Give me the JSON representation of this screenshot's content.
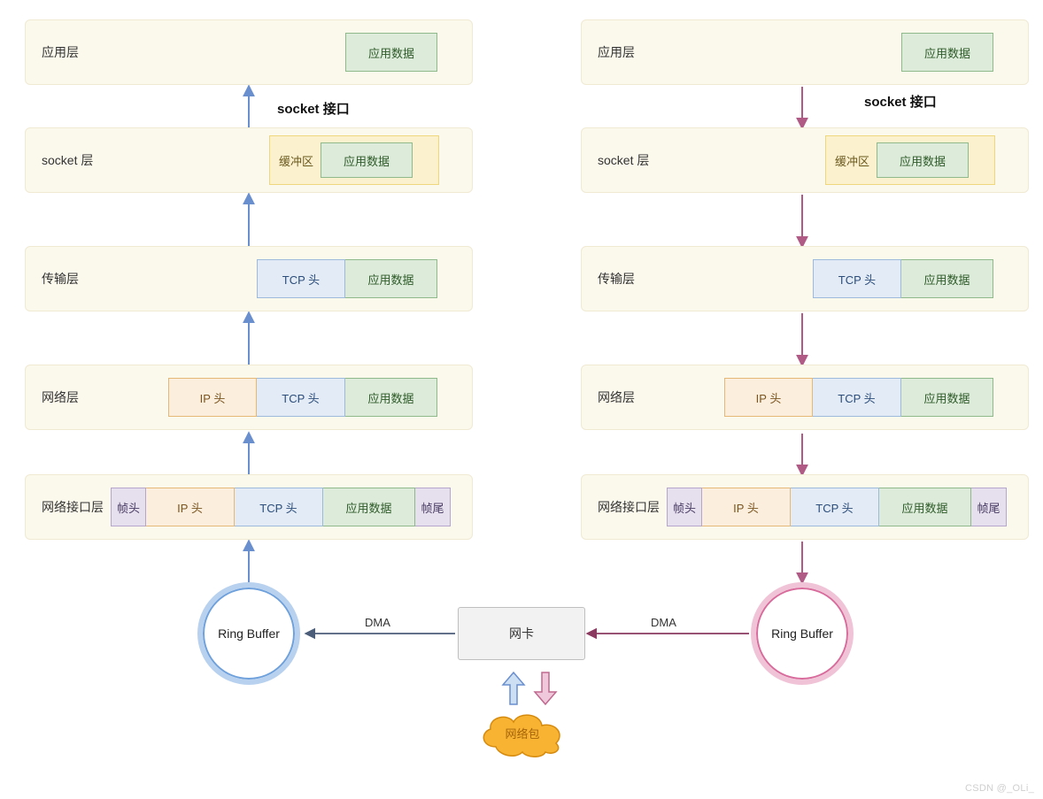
{
  "labels": {
    "socket_interface": "socket 接口",
    "ring_buffer": "Ring Buffer",
    "nic": "网卡",
    "dma": "DMA",
    "packet_cloud": "网络包",
    "buffer": "缓冲区"
  },
  "layers": {
    "app": "应用层",
    "socket": "socket 层",
    "transport": "传输层",
    "network": "网络层",
    "link": "网络接口层"
  },
  "segments": {
    "app_data": "应用数据",
    "tcp_header": "TCP 头",
    "ip_header": "IP 头",
    "frame_header": "帧头",
    "frame_tail": "帧尾"
  },
  "watermark": "CSDN @_OLi_"
}
